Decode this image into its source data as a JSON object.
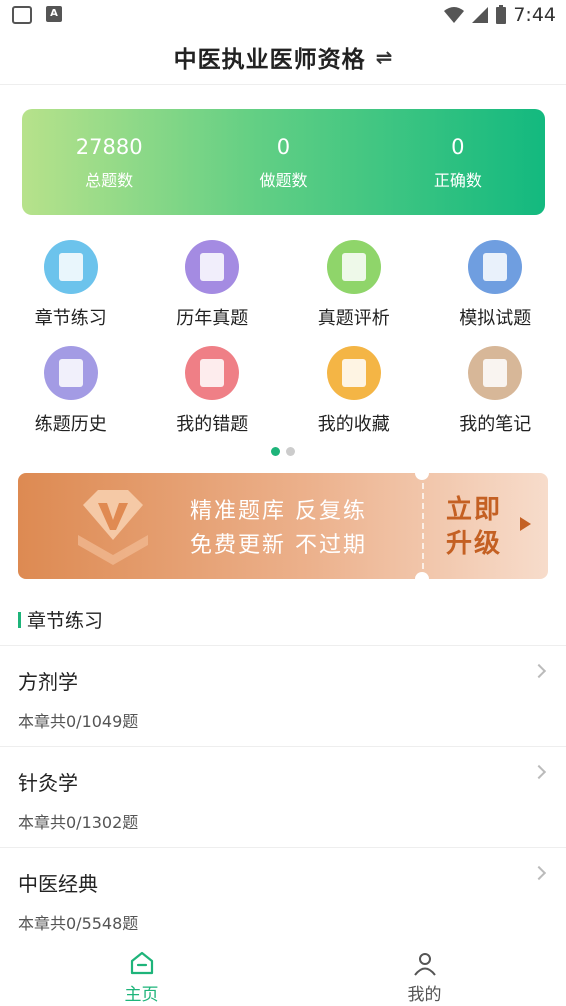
{
  "status_bar": {
    "time": "7:44"
  },
  "header": {
    "title": "中医执业医师资格",
    "swap_icon": "swap-arrows-icon"
  },
  "stats": [
    {
      "value": "27880",
      "label": "总题数"
    },
    {
      "value": "0",
      "label": "做题数"
    },
    {
      "value": "0",
      "label": "正确数"
    }
  ],
  "grid": [
    {
      "label": "章节练习",
      "icon": "open-book-icon",
      "color": "#6cc3ec"
    },
    {
      "label": "历年真题",
      "icon": "exam-paper-icon",
      "color": "#a48be2"
    },
    {
      "label": "真题评析",
      "icon": "document-stack-icon",
      "color": "#8fd56a"
    },
    {
      "label": "模拟试题",
      "icon": "edit-note-icon",
      "color": "#6f9ee0"
    },
    {
      "label": "练题历史",
      "icon": "calendar-history-icon",
      "color": "#a39be4"
    },
    {
      "label": "我的错题",
      "icon": "wrong-question-icon",
      "color": "#ef7f86"
    },
    {
      "label": "我的收藏",
      "icon": "box-collect-icon",
      "color": "#f4b545"
    },
    {
      "label": "我的笔记",
      "icon": "notebook-icon",
      "color": "#d7b798"
    }
  ],
  "pager": {
    "pages": 2,
    "active": 0
  },
  "banner": {
    "line1": "精准题库 反复练",
    "line2": "免费更新 不过期",
    "cta_line1": "立即",
    "cta_line2": "升级"
  },
  "section": {
    "title": "章节练习"
  },
  "chapters": [
    {
      "name": "方剂学",
      "count": "本章共0/1049题"
    },
    {
      "name": "针灸学",
      "count": "本章共0/1302题"
    },
    {
      "name": "中医经典",
      "count": "本章共0/5548题"
    }
  ],
  "tabbar": {
    "tabs": [
      {
        "label": "主页",
        "icon": "home-icon"
      },
      {
        "label": "我的",
        "icon": "user-icon"
      }
    ],
    "active_color": "#1eb47a"
  }
}
